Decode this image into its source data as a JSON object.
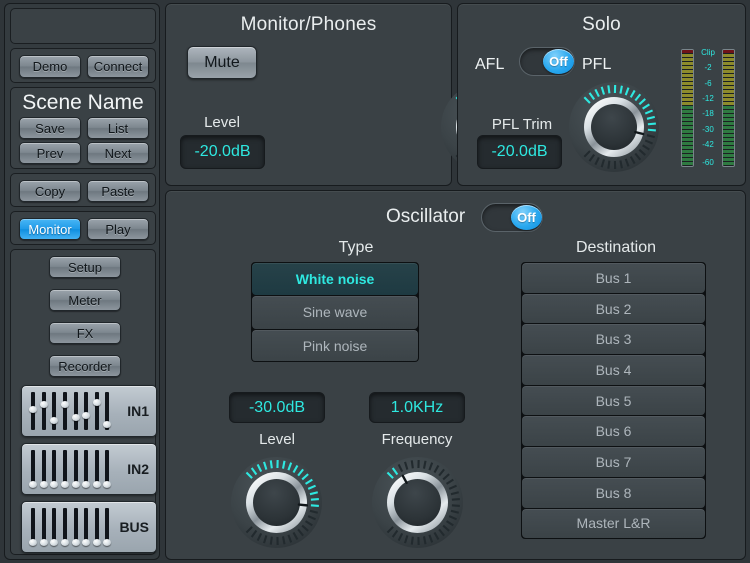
{
  "sidebar": {
    "status_bar": "",
    "connect_row": [
      {
        "label": "Demo",
        "name": "demo-button",
        "active": false
      },
      {
        "label": "Connect",
        "name": "connect-button",
        "active": false
      }
    ],
    "scene": {
      "title": "Scene Name",
      "buttons": [
        {
          "label": "Save",
          "name": "save-button"
        },
        {
          "label": "List",
          "name": "list-button"
        },
        {
          "label": "Prev",
          "name": "prev-button"
        },
        {
          "label": "Next",
          "name": "next-button"
        }
      ]
    },
    "clipboard": [
      {
        "label": "Copy",
        "name": "copy-button"
      },
      {
        "label": "Paste",
        "name": "paste-button"
      }
    ],
    "transport": [
      {
        "label": "Monitor",
        "name": "monitor-button",
        "active": true
      },
      {
        "label": "Play",
        "name": "play-button",
        "active": false
      }
    ],
    "nav": [
      {
        "label": "Setup",
        "name": "setup-button"
      },
      {
        "label": "Meter",
        "name": "meter-button"
      },
      {
        "label": "FX",
        "name": "fx-button"
      },
      {
        "label": "Recorder",
        "name": "recorder-button"
      }
    ],
    "fader_banks": [
      {
        "label": "IN1",
        "name": "fader-bank-in1",
        "positions": [
          0.46,
          0.3,
          0.82,
          0.28,
          0.7,
          0.66,
          0.24,
          0.92
        ]
      },
      {
        "label": "IN2",
        "name": "fader-bank-in2",
        "positions": [
          1,
          1,
          1,
          1,
          1,
          1,
          1,
          1
        ]
      },
      {
        "label": "BUS",
        "name": "fader-bank-bus",
        "positions": [
          1,
          1,
          1,
          1,
          1,
          1,
          1,
          1
        ]
      }
    ]
  },
  "monitor": {
    "title": "Monitor/Phones",
    "mute_label": "Mute",
    "level_caption": "Level",
    "level_value": "-20.0dB",
    "knob_value_pct": 0.55
  },
  "solo": {
    "title": "Solo",
    "afl_label": "AFL",
    "pfl_label": "PFL",
    "toggle_state": "Off",
    "trim_caption": "PFL Trim",
    "trim_value": "-20.0dB",
    "knob_value_pct": 0.55
  },
  "oscillator": {
    "title": "Oscillator",
    "toggle_state": "Off",
    "type_caption": "Type",
    "types": [
      {
        "label": "White noise",
        "selected": true
      },
      {
        "label": "Sine wave",
        "selected": false
      },
      {
        "label": "Pink noise",
        "selected": false
      }
    ],
    "level_caption": "Level",
    "level_value": "-30.0dB",
    "level_knob_pct": 0.52,
    "frequency_caption": "Frequency",
    "frequency_value": "1.0KHz",
    "frequency_knob_pct": 0.06,
    "destination_caption": "Destination",
    "destinations": [
      {
        "label": "Bus 1",
        "selected": false
      },
      {
        "label": "Bus 2",
        "selected": false
      },
      {
        "label": "Bus 3",
        "selected": false
      },
      {
        "label": "Bus 4",
        "selected": false
      },
      {
        "label": "Bus 5",
        "selected": false
      },
      {
        "label": "Bus 6",
        "selected": false
      },
      {
        "label": "Bus 7",
        "selected": false
      },
      {
        "label": "Bus 8",
        "selected": false
      },
      {
        "label": "Master L&R",
        "selected": false
      }
    ]
  },
  "meters": {
    "scale_labels": [
      "Clip",
      "-2",
      "-6",
      "-12",
      "-18",
      "-30",
      "-42",
      "-60"
    ],
    "scale_positions_pct": [
      0,
      13,
      26,
      39,
      52,
      65,
      78,
      93
    ],
    "monitor_left_level_pct": 100,
    "monitor_right_level_pct": 100,
    "solo_left_level_pct": 100,
    "solo_right_level_pct": 100
  },
  "colors": {
    "accent_cyan": "#2ee8e0",
    "accent_blue": "#1f9ae8",
    "panel_bg": "#3a4145",
    "window_bg": "#2f3539",
    "meter_red": "#6e1318",
    "meter_yellow": "#8d8b2c",
    "meter_green": "#2f7a41"
  }
}
